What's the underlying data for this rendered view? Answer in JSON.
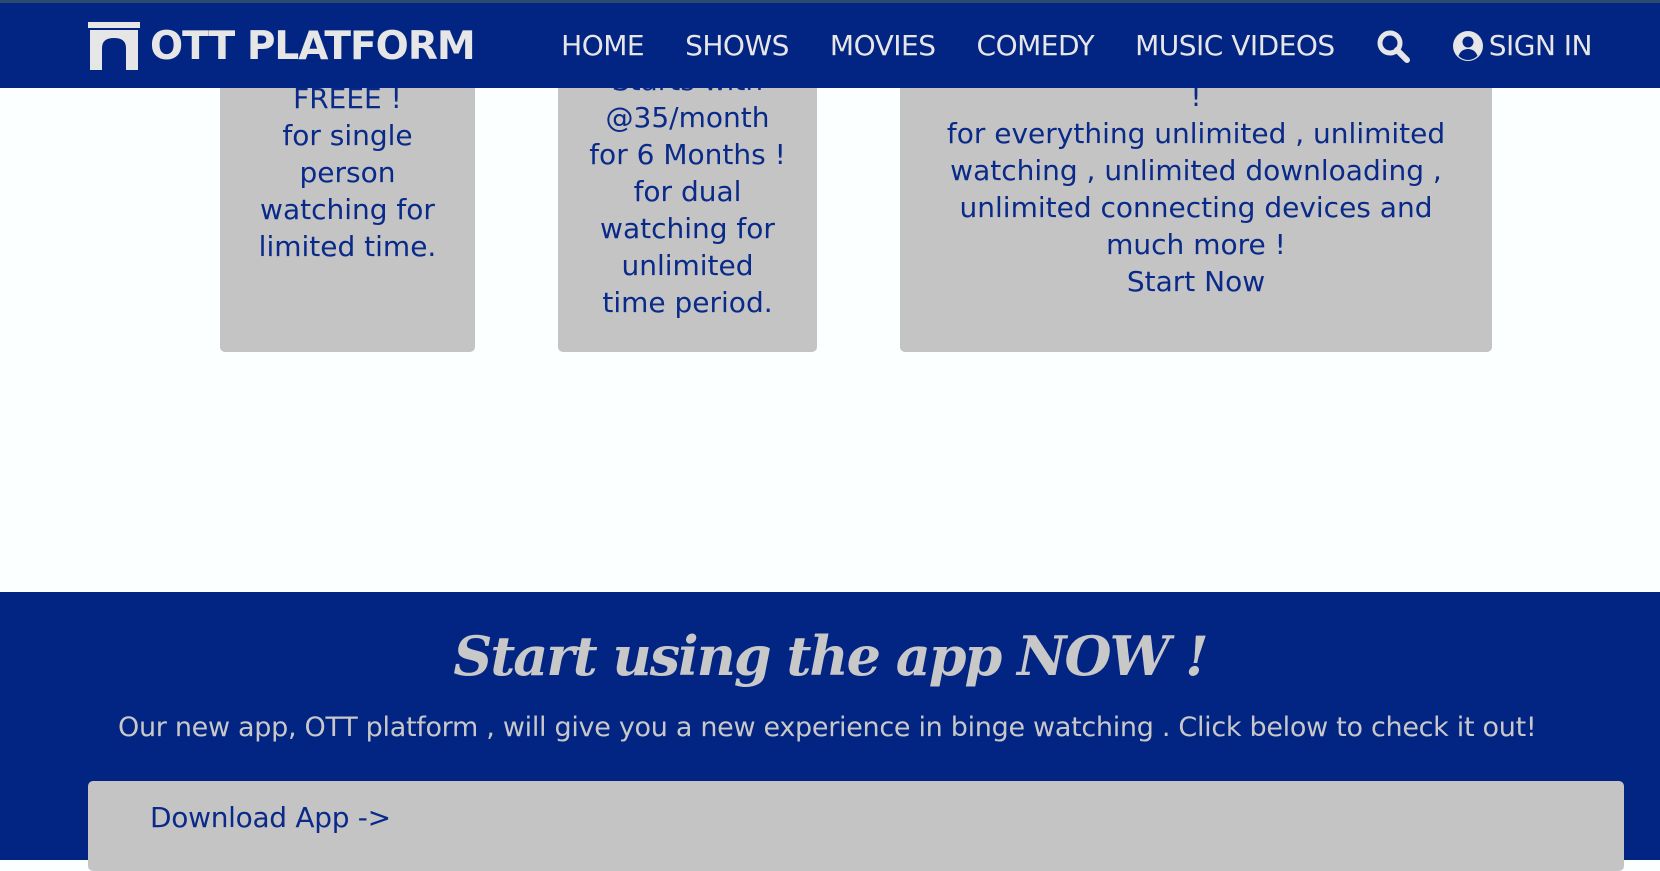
{
  "navbar": {
    "brand": "OTT PLATFORM",
    "links": [
      "HOME",
      "SHOWS",
      "MOVIES",
      "COMEDY",
      "MUSIC VIDEOS"
    ],
    "signin_label": "SIGN IN",
    "icons": {
      "brand": "arch-logo-icon",
      "search": "search-icon",
      "user": "user-circle-icon"
    }
  },
  "plans": [
    {
      "lines": [
        "FREEE !",
        "for single",
        "person",
        "watching for",
        "limited time."
      ]
    },
    {
      "lines": [
        "Starts with",
        "@35/month",
        "for 6 Months !",
        "for dual",
        "watching for",
        "unlimited",
        "time period."
      ]
    },
    {
      "lines": [
        "!",
        "for everything unlimited , unlimited",
        "watching , unlimited downloading ,",
        "unlimited connecting devices and",
        "much more !",
        "Start Now"
      ]
    }
  ],
  "cta": {
    "title": "Start using the app NOW !",
    "text": "Our new app, OTT platform , will give you a new experience in binge watching . Click below to check it out!",
    "download_label": "Download App ->"
  },
  "colors": {
    "navbar": "#022583",
    "card": "#c4c4c4",
    "card_text": "#0a2a8a",
    "page": "#fcffff"
  }
}
